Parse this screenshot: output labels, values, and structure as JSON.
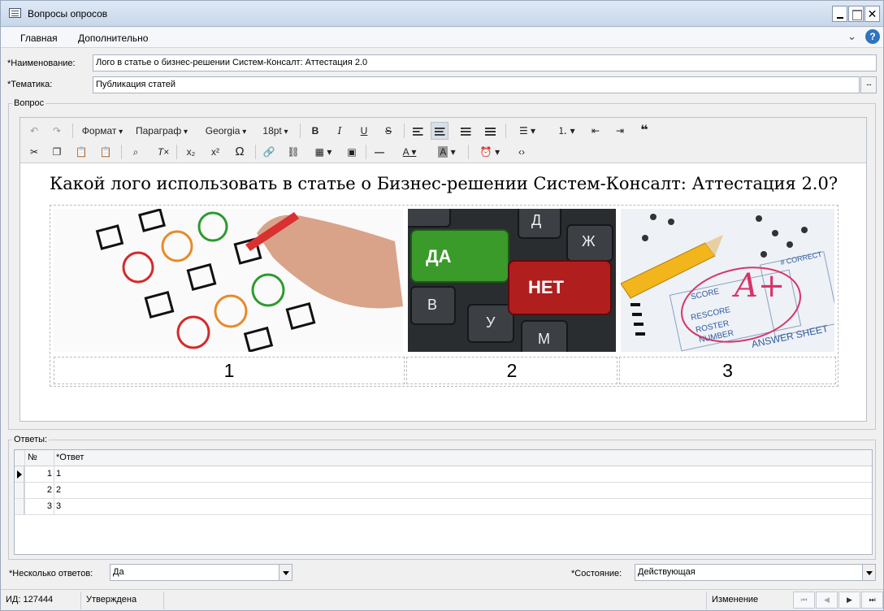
{
  "window": {
    "title": "Вопросы опросов"
  },
  "menu": {
    "home": "Главная",
    "extra": "Дополнительно",
    "help": "?"
  },
  "form": {
    "name_label": "*Наименование:",
    "name_value": "Лого в статье о бизнес-решении Систем-Консалт: Аттестация 2.0",
    "topic_label": "*Тематика:",
    "topic_value": "Публикация статей",
    "topic_button": "...",
    "question_group": "Вопрос",
    "answers_group": "Ответы:",
    "multi_label": "*Несколько ответов:",
    "multi_value": "Да",
    "state_label": "*Состояние:",
    "state_value": "Действующая"
  },
  "editor": {
    "format": "Формат",
    "paragraph": "Параграф",
    "font": "Georgia",
    "size": "18pt",
    "heading": "Какой лого использовать в статье о Бизнес-решении Систем-Консалт: Аттестация 2.0?",
    "images": {
      "yes_key": "ДА",
      "no_key": "НЕТ",
      "key_d": "Д",
      "key_zh": "Ж",
      "key_v": "В",
      "key_u": "У",
      "key_m": "М",
      "grade": "A+",
      "sheet_score": "SCORE",
      "sheet_rescore": "RESCORE",
      "sheet_roster": "ROSTER",
      "sheet_number": "NUMBER",
      "sheet_answer": "ANSWER SHEET",
      "sheet_correct": "# CORRECT"
    },
    "cells": [
      "1",
      "2",
      "3"
    ]
  },
  "grid": {
    "columns": [
      "№",
      "*Ответ"
    ],
    "rows": [
      {
        "num": "1",
        "answer": "1"
      },
      {
        "num": "2",
        "answer": "2"
      },
      {
        "num": "3",
        "answer": "3"
      }
    ]
  },
  "status": {
    "id": "ИД: 127444",
    "state": "Утверждена",
    "mode": "Изменение"
  },
  "colors": {
    "help": "#2f74c0",
    "yes_key": "#3a9a2a",
    "no_key": "#b01e1e",
    "pencil": "#f2b51c"
  }
}
